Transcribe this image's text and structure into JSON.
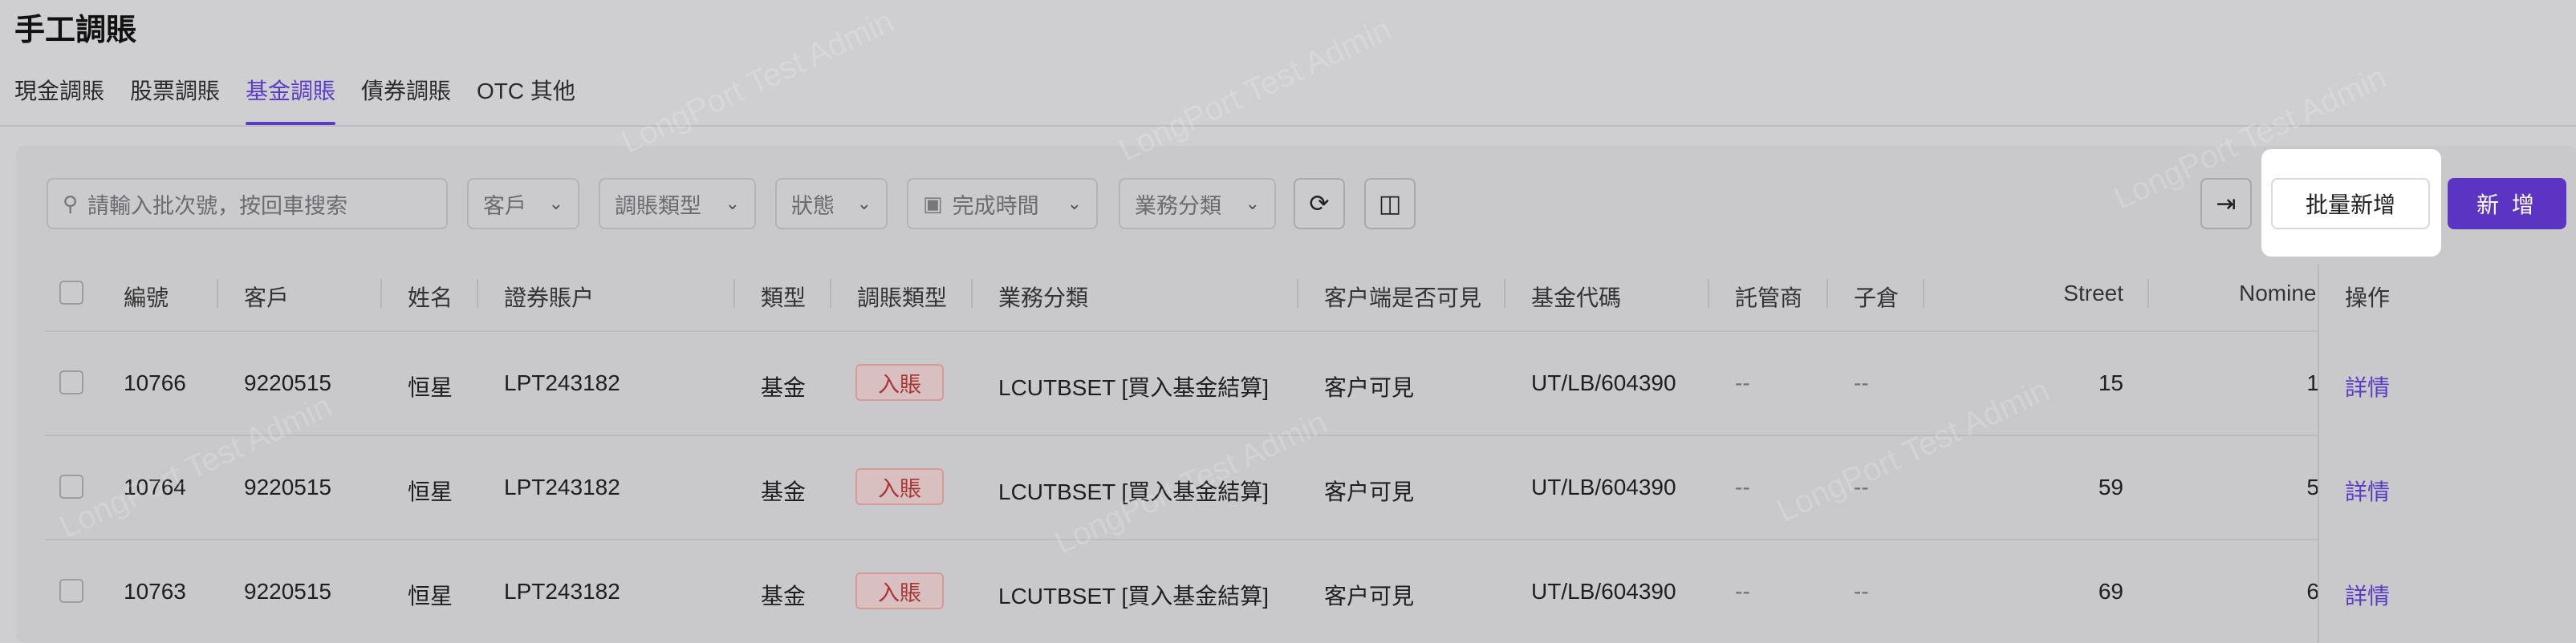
{
  "page": {
    "title": "手工調賬"
  },
  "tabs": [
    {
      "label": "現金調賬"
    },
    {
      "label": "股票調賬"
    },
    {
      "label": "基金調賬"
    },
    {
      "label": "債券調賬"
    },
    {
      "label": "OTC 其他"
    }
  ],
  "active_tab": "基金調賬",
  "toolbar": {
    "search_placeholder": "請輸入批次號，按回車搜索",
    "filter_customer": "客戶",
    "filter_adjust_type": "調賬類型",
    "filter_status": "狀態",
    "filter_complete_time": "完成時間",
    "filter_business_category": "業務分類",
    "batch_add_label": "批量新增",
    "add_label": "新 增"
  },
  "table": {
    "headers": {
      "id": "編號",
      "customer": "客戶",
      "name": "姓名",
      "account": "證券賬户",
      "type": "類型",
      "adjust_type": "調賬類型",
      "business_category": "業務分類",
      "client_visible": "客户端是否可見",
      "fund_code": "基金代碼",
      "custodian": "託管商",
      "sub_warehouse": "子倉",
      "street": "Street",
      "nominee": "Nomine",
      "actions": "操作"
    },
    "rows": [
      {
        "id": "10766",
        "customer": "9220515",
        "name": "恒星",
        "account": "LPT243182",
        "type": "基金",
        "adjust_type": "入賬",
        "business_category": "LCUTBSET [買入基金結算]",
        "client_visible": "客户可見",
        "fund_code": "UT/LB/604390",
        "custodian": "--",
        "sub_warehouse": "--",
        "street": "15",
        "nominee": "1",
        "action": "詳情"
      },
      {
        "id": "10764",
        "customer": "9220515",
        "name": "恒星",
        "account": "LPT243182",
        "type": "基金",
        "adjust_type": "入賬",
        "business_category": "LCUTBSET [買入基金結算]",
        "client_visible": "客户可見",
        "fund_code": "UT/LB/604390",
        "custodian": "--",
        "sub_warehouse": "--",
        "street": "59",
        "nominee": "5",
        "action": "詳情"
      },
      {
        "id": "10763",
        "customer": "9220515",
        "name": "恒星",
        "account": "LPT243182",
        "type": "基金",
        "adjust_type": "入賬",
        "business_category": "LCUTBSET [買入基金結算]",
        "client_visible": "客户可見",
        "fund_code": "UT/LB/604390",
        "custodian": "--",
        "sub_warehouse": "--",
        "street": "69",
        "nominee": "6",
        "action": "詳情"
      }
    ]
  },
  "watermark": "LongPort Test Admin",
  "colors": {
    "accent": "#5b34c4",
    "tag_text": "#a83434",
    "overlay": "#cfcfd1"
  }
}
